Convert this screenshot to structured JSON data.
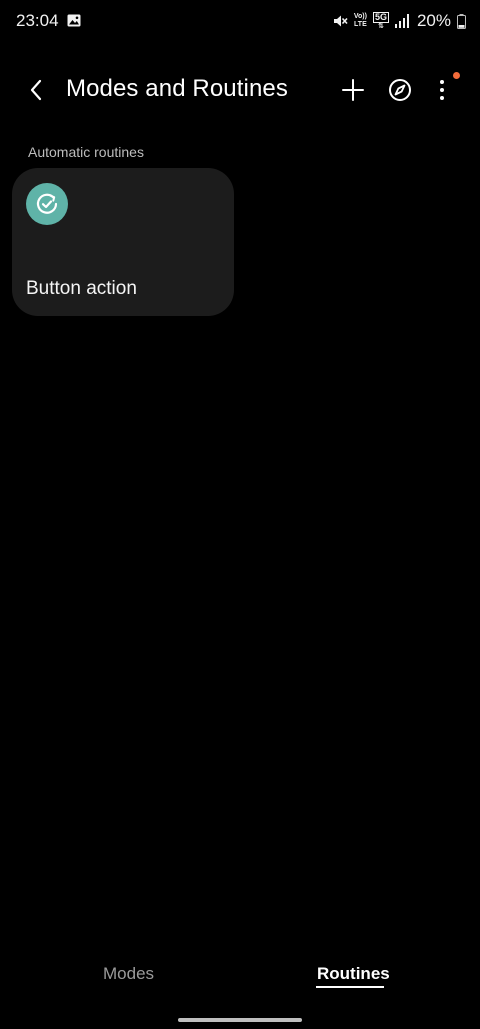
{
  "status_bar": {
    "time": "23:04",
    "battery_percent": "20%",
    "volte_top": "Vo))",
    "volte_bottom": "LTE",
    "network_type": "5G",
    "icons": [
      "gallery-icon",
      "mute-icon",
      "volte-icon",
      "5g-icon",
      "signal-icon",
      "battery-icon"
    ]
  },
  "app_bar": {
    "title": "Modes and Routines",
    "icons": [
      "back-icon",
      "plus-icon",
      "compass-icon",
      "more-vertical-icon"
    ],
    "notification_color": "#f26b3a"
  },
  "section": {
    "header": "Automatic routines"
  },
  "routines": [
    {
      "name": "Button action",
      "icon": "routine-check-icon",
      "icon_color": "#5fb3a8"
    }
  ],
  "tabs": {
    "modes": "Modes",
    "routines": "Routines",
    "selected": "Routines"
  }
}
